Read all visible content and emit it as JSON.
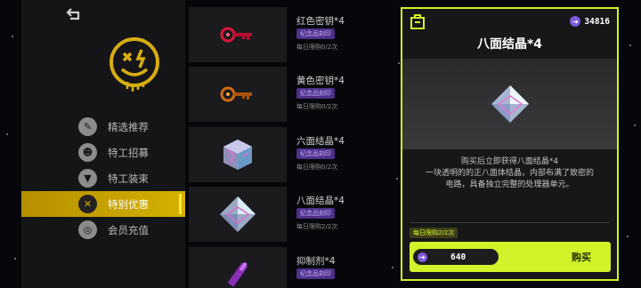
{
  "menu": {
    "items": [
      {
        "label": "精选推荐",
        "icon": "tag-icon"
      },
      {
        "label": "特工招募",
        "icon": "agent-face-icon"
      },
      {
        "label": "特工装束",
        "icon": "shirt-icon"
      },
      {
        "label": "特别优惠",
        "icon": "tools-icon",
        "active": true
      },
      {
        "label": "会员充值",
        "icon": "coin-ring-icon"
      }
    ]
  },
  "items": [
    {
      "name": "红色密钥*4",
      "badge": "纪念品刻印",
      "limit": "每日限购0/2次",
      "icon": "red-key-icon"
    },
    {
      "name": "黄色密钥*4",
      "badge": "纪念品刻印",
      "limit": "每日限购0/2次",
      "icon": "yellow-key-icon"
    },
    {
      "name": "六面结晶*4",
      "badge": "纪念品刻印",
      "limit": "每日限购0/2次",
      "icon": "hexahedron-crystal-icon"
    },
    {
      "name": "八面结晶*4",
      "badge": "纪念品刻印",
      "limit": "每日限购2/2次",
      "icon": "octahedron-crystal-icon"
    },
    {
      "name": "抑制剂*4",
      "badge": "纪念品刻印",
      "icon": "inhibitor-syringe-icon"
    }
  ],
  "panel": {
    "currency": "34816",
    "title": "八面结晶*4",
    "desc_line1": "购买后立即获得八面结晶*4",
    "desc_line2": "一块透明的的正八面体结晶，内部布满了致密的",
    "desc_line3": "电路，具备独立完整的处理器单元。",
    "daily_limit": "每日限购2/2次",
    "price": "640",
    "buy_label": "购买"
  },
  "colors": {
    "accent": "#d2f22a",
    "menu_active": "#d4b100",
    "badge_bg": "#4c2f86",
    "coin": "#7a5bd8"
  }
}
